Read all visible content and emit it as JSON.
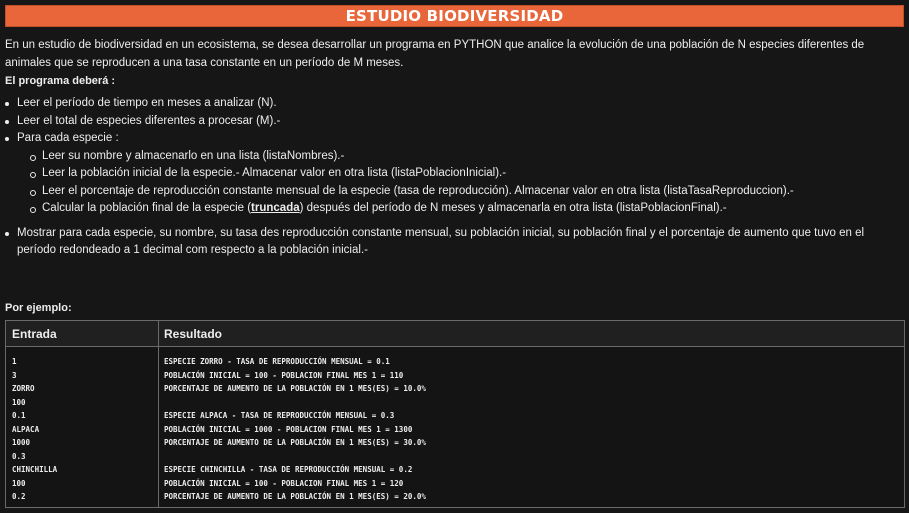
{
  "title": "ESTUDIO BIODIVERSIDAD",
  "intro": "En un estudio de biodiversidad en un ecosistema, se desea desarrollar un programa en PYTHON que analice la evolución de una población de N especies diferentes de animales que se reproducen a una tasa constante en un período de M meses.",
  "subheading": "El programa deberá :",
  "bullets": {
    "b1": "Leer el período de tiempo en meses a analizar (N).",
    "b2": "Leer el total de especies diferentes a procesar (M).-",
    "b3": "Para cada especie :",
    "sub1": "Leer su nombre y almacenarlo en una lista (listaNombres).-",
    "sub2": "Leer la población inicial de la especie.- Almacenar valor en otra lista (listaPoblacionInicial).-",
    "sub3": "Leer el porcentaje de reproducción constante mensual de la especie (tasa de reproducción). Almacenar valor en otra lista (listaTasaReproduccion).-",
    "sub4_pre": "Calcular la población final de la especie (",
    "sub4_bold": "truncada",
    "sub4_post": ") después del período de N meses y almacenarla en otra lista (listaPoblacionFinal).-",
    "b4": "Mostrar para cada especie, su nombre, su tasa des reproducción constante mensual, su población inicial, su población final y el porcentaje de aumento que tuvo en el período redondeado a 1 decimal com respecto a la población inicial.-"
  },
  "example_label": "Por ejemplo:",
  "table": {
    "header_entrada": "Entrada",
    "header_resultado": "Resultado",
    "entrada": "1\n3\nZORRO\n100\n0.1\nALPACA\n1000\n0.3\nCHINCHILLA\n100\n0.2",
    "resultado": "ESPECIE ZORRO - TASA DE REPRODUCCIÓN MENSUAL = 0.1\nPOBLACIÓN INICIAL = 100 - POBLACION FINAL MES 1 = 110\nPORCENTAJE DE AUMENTO DE LA POBLACIÓN EN 1 MES(ES) = 10.0%\n\nESPECIE ALPACA - TASA DE REPRODUCCIÓN MENSUAL = 0.3\nPOBLACIÓN INICIAL = 1000 - POBLACION FINAL MES 1 = 1300\nPORCENTAJE DE AUMENTO DE LA POBLACIÓN EN 1 MES(ES) = 30.0%\n\nESPECIE CHINCHILLA - TASA DE REPRODUCCIÓN MENSUAL = 0.2\nPOBLACIÓN INICIAL = 100 - POBLACION FINAL MES 1 = 120\nPORCENTAJE DE AUMENTO DE LA POBLACIÓN EN 1 MES(ES) = 20.0%"
  },
  "colors": {
    "banner": "#e8663a",
    "background": "#161616",
    "text": "#ededed"
  }
}
